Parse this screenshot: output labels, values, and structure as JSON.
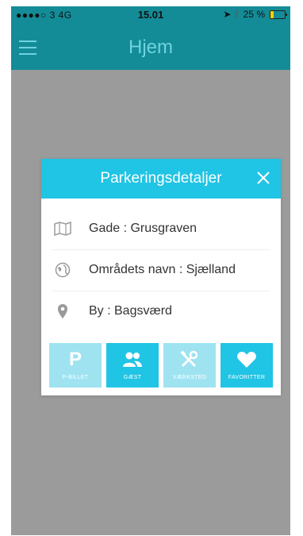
{
  "status_bar": {
    "signal": "●●●●○ 3  4G",
    "time": "15.01",
    "battery_text": "25 %"
  },
  "header": {
    "title": "Hjem"
  },
  "modal": {
    "title": "Parkeringsdetaljer",
    "rows": [
      {
        "icon": "map-icon",
        "text": "Gade : Grusgraven"
      },
      {
        "icon": "globe-icon",
        "text": "Områdets navn : Sjælland"
      },
      {
        "icon": "location-pin-icon",
        "text": "By : Bagsværd"
      }
    ],
    "actions": [
      {
        "label": "P-BILLET",
        "icon": "parking-icon",
        "color": "#9fe3f1"
      },
      {
        "label": "GÆST",
        "icon": "users-icon",
        "color": "#20c4e4"
      },
      {
        "label": "VÆRKSTED",
        "icon": "tools-icon",
        "color": "#9fe3f1"
      },
      {
        "label": "FAVORITTER",
        "icon": "heart-icon",
        "color": "#20c4e4"
      }
    ]
  },
  "colors": {
    "header_bg": "#138c98",
    "overlay_bg": "#9b9b9b",
    "modal_header": "#20c4e4",
    "title_text": "#6fd3df"
  }
}
